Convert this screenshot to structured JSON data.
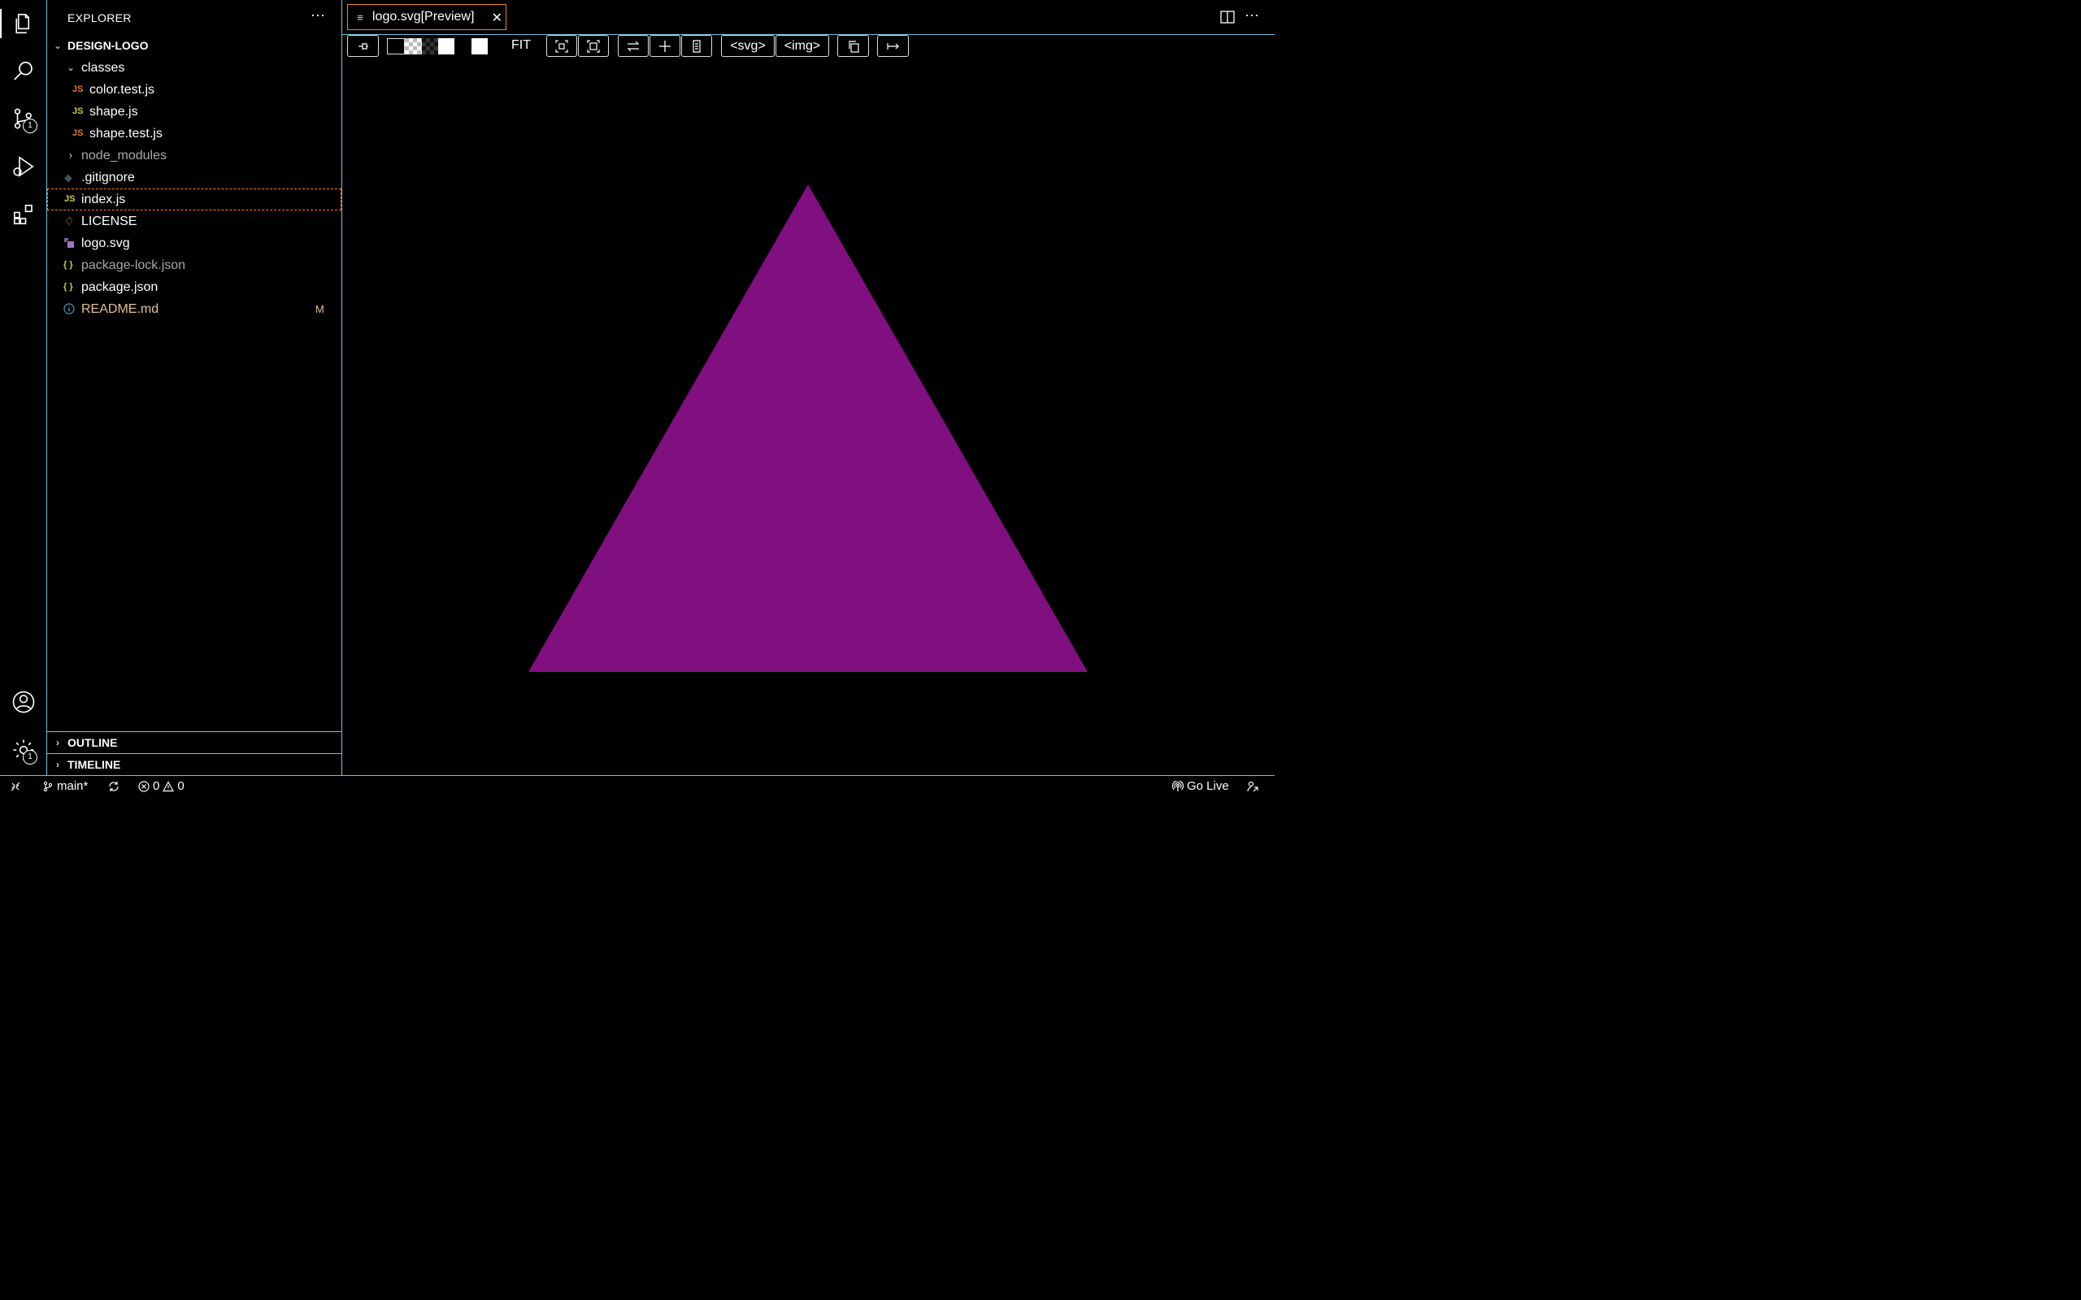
{
  "explorer": {
    "title": "EXPLORER",
    "more_label": "···",
    "project": "DESIGN-LOGO",
    "tree": [
      {
        "label": "classes",
        "kind": "folder-open",
        "indent": 1
      },
      {
        "label": "color.test.js",
        "kind": "js-test",
        "indent": 2
      },
      {
        "label": "shape.js",
        "kind": "js",
        "indent": 2
      },
      {
        "label": "shape.test.js",
        "kind": "js-test",
        "indent": 2
      },
      {
        "label": "node_modules",
        "kind": "folder-closed",
        "indent": 1,
        "dim": true
      },
      {
        "label": ".gitignore",
        "kind": "git",
        "indent": 1
      },
      {
        "label": "index.js",
        "kind": "js",
        "indent": 1,
        "selected": true
      },
      {
        "label": "LICENSE",
        "kind": "license",
        "indent": 1
      },
      {
        "label": "logo.svg",
        "kind": "svg",
        "indent": 1
      },
      {
        "label": "package-lock.json",
        "kind": "json",
        "indent": 1,
        "dim": true
      },
      {
        "label": "package.json",
        "kind": "json",
        "indent": 1
      },
      {
        "label": "README.md",
        "kind": "info",
        "indent": 1,
        "modified": true,
        "badge": "M"
      }
    ],
    "sections": [
      "OUTLINE",
      "TIMELINE"
    ]
  },
  "icons": {
    "js": "JS",
    "json": "{ }"
  },
  "activity": {
    "scm_badge": "1",
    "settings_badge": "1"
  },
  "editor": {
    "tab_label": "logo.svg[Preview]",
    "more_label": "···",
    "toolbar": {
      "fit_label": "FIT",
      "svg_label": "<svg>",
      "img_label": "<img>"
    },
    "preview": {
      "shape": "triangle",
      "fill": "#800f80"
    }
  },
  "statusbar": {
    "branch": "main*",
    "errors": "0",
    "warnings": "0",
    "golive": "Go Live"
  },
  "colors": {
    "border": "#6fc3df",
    "focus": "#f38518",
    "modified": "#e2c08d",
    "js_yellow": "#cbcb41",
    "js_test": "#e37933"
  }
}
